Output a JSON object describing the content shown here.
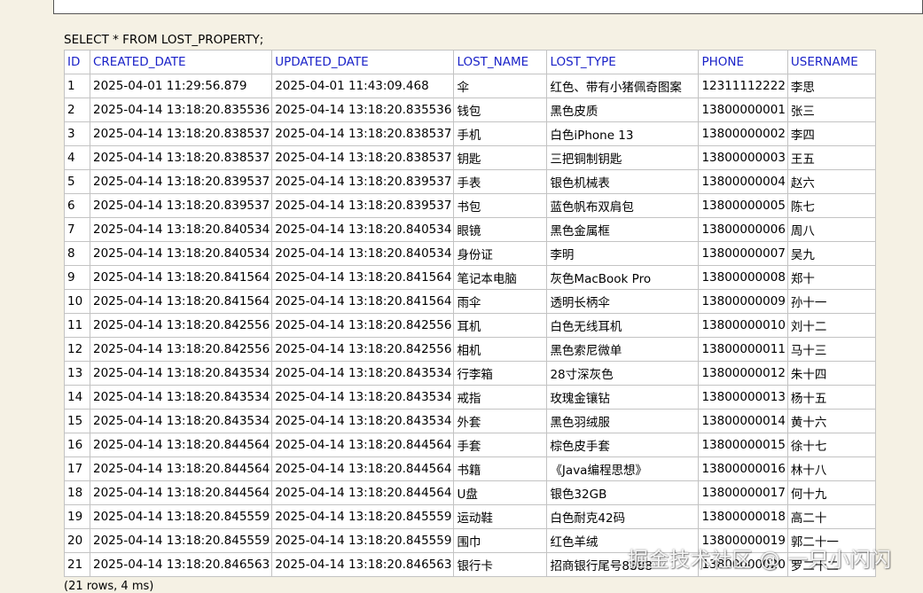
{
  "query": "SELECT * FROM LOST_PROPERTY;",
  "columns": [
    "ID",
    "CREATED_DATE",
    "UPDATED_DATE",
    "LOST_NAME",
    "LOST_TYPE",
    "PHONE",
    "USERNAME"
  ],
  "rows": [
    [
      "1",
      "2025-04-01 11:29:56.879",
      "2025-04-01 11:43:09.468",
      "伞",
      "红色、带有小猪佩奇图案",
      "12311112222",
      "李思"
    ],
    [
      "2",
      "2025-04-14 13:18:20.835536",
      "2025-04-14 13:18:20.835536",
      "钱包",
      "黑色皮质",
      "13800000001",
      "张三"
    ],
    [
      "3",
      "2025-04-14 13:18:20.838537",
      "2025-04-14 13:18:20.838537",
      "手机",
      "白色iPhone 13",
      "13800000002",
      "李四"
    ],
    [
      "4",
      "2025-04-14 13:18:20.838537",
      "2025-04-14 13:18:20.838537",
      "钥匙",
      "三把铜制钥匙",
      "13800000003",
      "王五"
    ],
    [
      "5",
      "2025-04-14 13:18:20.839537",
      "2025-04-14 13:18:20.839537",
      "手表",
      "银色机械表",
      "13800000004",
      "赵六"
    ],
    [
      "6",
      "2025-04-14 13:18:20.839537",
      "2025-04-14 13:18:20.839537",
      "书包",
      "蓝色帆布双肩包",
      "13800000005",
      "陈七"
    ],
    [
      "7",
      "2025-04-14 13:18:20.840534",
      "2025-04-14 13:18:20.840534",
      "眼镜",
      "黑色金属框",
      "13800000006",
      "周八"
    ],
    [
      "8",
      "2025-04-14 13:18:20.840534",
      "2025-04-14 13:18:20.840534",
      "身份证",
      "李明",
      "13800000007",
      "吴九"
    ],
    [
      "9",
      "2025-04-14 13:18:20.841564",
      "2025-04-14 13:18:20.841564",
      "笔记本电脑",
      "灰色MacBook Pro",
      "13800000008",
      "郑十"
    ],
    [
      "10",
      "2025-04-14 13:18:20.841564",
      "2025-04-14 13:18:20.841564",
      "雨伞",
      "透明长柄伞",
      "13800000009",
      "孙十一"
    ],
    [
      "11",
      "2025-04-14 13:18:20.842556",
      "2025-04-14 13:18:20.842556",
      "耳机",
      "白色无线耳机",
      "13800000010",
      "刘十二"
    ],
    [
      "12",
      "2025-04-14 13:18:20.842556",
      "2025-04-14 13:18:20.842556",
      "相机",
      "黑色索尼微单",
      "13800000011",
      "马十三"
    ],
    [
      "13",
      "2025-04-14 13:18:20.843534",
      "2025-04-14 13:18:20.843534",
      "行李箱",
      "28寸深灰色",
      "13800000012",
      "朱十四"
    ],
    [
      "14",
      "2025-04-14 13:18:20.843534",
      "2025-04-14 13:18:20.843534",
      "戒指",
      "玫瑰金镶钻",
      "13800000013",
      "杨十五"
    ],
    [
      "15",
      "2025-04-14 13:18:20.843534",
      "2025-04-14 13:18:20.843534",
      "外套",
      "黑色羽绒服",
      "13800000014",
      "黄十六"
    ],
    [
      "16",
      "2025-04-14 13:18:20.844564",
      "2025-04-14 13:18:20.844564",
      "手套",
      "棕色皮手套",
      "13800000015",
      "徐十七"
    ],
    [
      "17",
      "2025-04-14 13:18:20.844564",
      "2025-04-14 13:18:20.844564",
      "书籍",
      "《Java编程思想》",
      "13800000016",
      "林十八"
    ],
    [
      "18",
      "2025-04-14 13:18:20.844564",
      "2025-04-14 13:18:20.844564",
      "U盘",
      "银色32GB",
      "13800000017",
      "何十九"
    ],
    [
      "19",
      "2025-04-14 13:18:20.845559",
      "2025-04-14 13:18:20.845559",
      "运动鞋",
      "白色耐克42码",
      "13800000018",
      "高二十"
    ],
    [
      "20",
      "2025-04-14 13:18:20.845559",
      "2025-04-14 13:18:20.845559",
      "围巾",
      "红色羊绒",
      "13800000019",
      "郭二十一"
    ],
    [
      "21",
      "2025-04-14 13:18:20.846563",
      "2025-04-14 13:18:20.846563",
      "银行卡",
      "招商银行尾号8888",
      "13800000020",
      "罗二十二"
    ]
  ],
  "footer": "(21 rows, 4 ms)",
  "watermark": "掘金技术社区 @ 一只小闪闪",
  "colors": {
    "header_text": "#1a22c8",
    "background": "#f5f1e4",
    "grid": "#c3c3c3"
  }
}
